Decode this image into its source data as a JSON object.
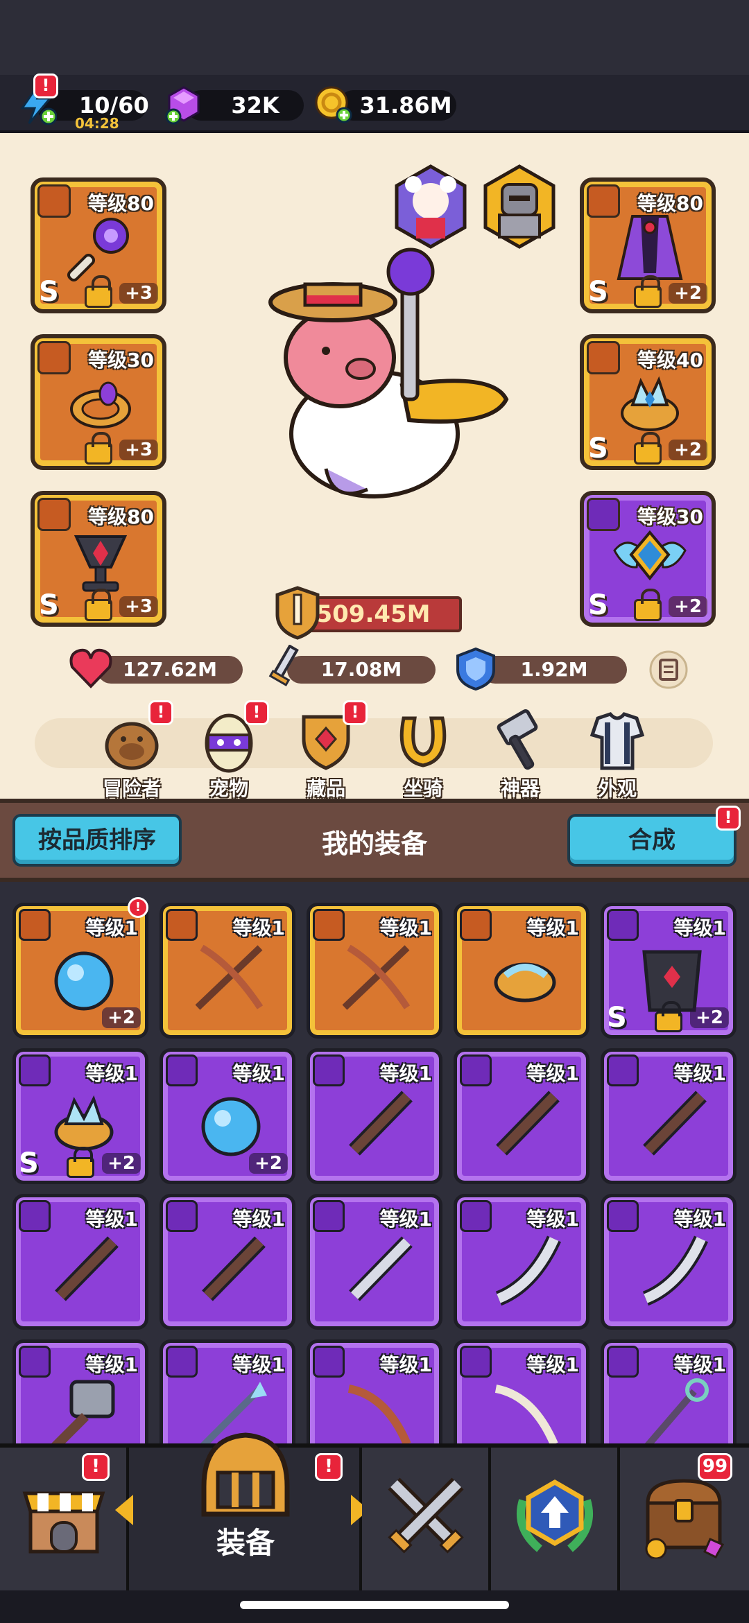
{
  "resources": {
    "energy": "10/60",
    "energy_timer": "04:28",
    "gems": "32K",
    "coins": "31.86M"
  },
  "badges": {
    "alert": "!",
    "chest_count": "99"
  },
  "equipped": {
    "weapon": {
      "level": "等级80",
      "plus": "+3",
      "grade": "S"
    },
    "ring": {
      "level": "等级30",
      "plus": "+3"
    },
    "necklace": {
      "level": "等级80",
      "plus": "+3",
      "grade": "S"
    },
    "armor": {
      "level": "等级80",
      "plus": "+2",
      "grade": "S"
    },
    "belt": {
      "level": "等级40",
      "plus": "+2",
      "grade": "S"
    },
    "amulet": {
      "level": "等级30",
      "plus": "+2",
      "grade": "S"
    }
  },
  "power": "509.45M",
  "stats": {
    "hp": "127.62M",
    "attack": "17.08M",
    "defense": "1.92M"
  },
  "nav": [
    {
      "label": "冒险者"
    },
    {
      "label": "宠物"
    },
    {
      "label": "藏品"
    },
    {
      "label": "坐骑"
    },
    {
      "label": "神器"
    },
    {
      "label": "外观"
    }
  ],
  "section": {
    "sort_button": "按品质排序",
    "title": "我的装备",
    "merge_button": "合成"
  },
  "inventory_level": "等级1",
  "inventory_plus": "+2",
  "inventory_grade": "S",
  "bottom_nav": {
    "active_label": "装备"
  },
  "colors": {
    "orange_tile": "#d9772f",
    "purple_tile": "#8d3fd8",
    "accent_cyan": "#47c6e6",
    "alert_red": "#e8243a"
  }
}
